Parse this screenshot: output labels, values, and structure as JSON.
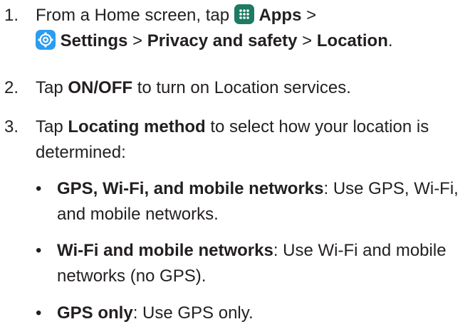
{
  "steps": [
    {
      "number": "1.",
      "prefix": "From a Home screen, tap ",
      "apps": "Apps",
      "sep1": " >",
      "settings": "Settings",
      "sep2": " > ",
      "privacy": "Privacy and safety",
      "sep3": " > ",
      "location": "Location",
      "end": "."
    },
    {
      "number": "2.",
      "prefix": "Tap ",
      "onoff": "ON/OFF",
      "suffix": " to turn on Location services."
    },
    {
      "number": "3.",
      "prefix": "Tap ",
      "method": "Locating method",
      "suffix": " to select how your location is determined:"
    }
  ],
  "bullets": [
    {
      "dot": "•",
      "title": "GPS, Wi-Fi, and mobile networks",
      "desc": ": Use GPS, Wi-Fi, and mobile networks."
    },
    {
      "dot": "•",
      "title": "Wi-Fi and mobile networks",
      "desc": ": Use Wi-Fi and mobile networks (no GPS)."
    },
    {
      "dot": "•",
      "title": "GPS only",
      "desc": ": Use GPS only."
    }
  ],
  "icons": {
    "apps": "apps-grid-icon",
    "settings": "settings-gear-icon"
  },
  "colors": {
    "text": "#231f20",
    "apps_icon": "#1f7a63",
    "settings_icon": "#2b9cf0"
  }
}
